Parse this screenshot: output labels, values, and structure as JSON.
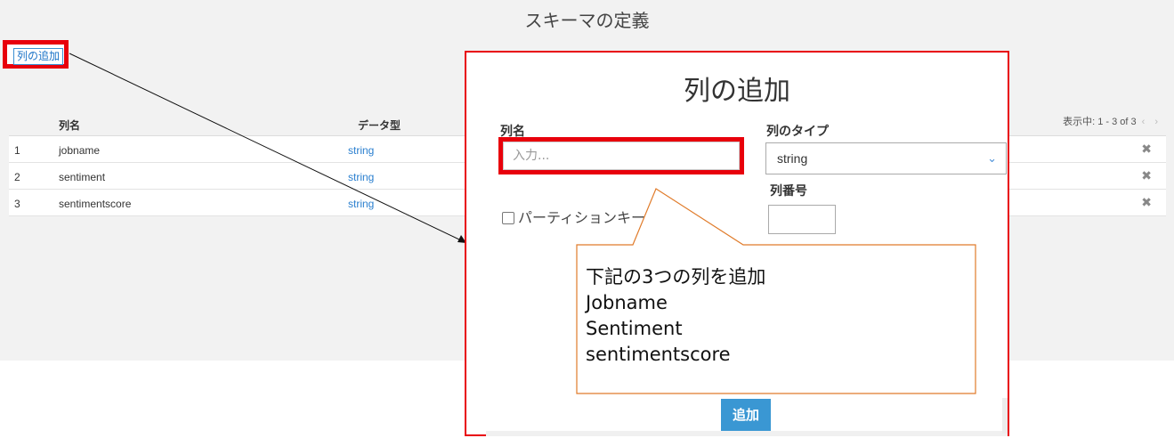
{
  "page": {
    "title": "スキーマの定義"
  },
  "toolbar": {
    "add_column_label": "列の追加"
  },
  "pager": {
    "text": "表示中: 1 - 3 of 3",
    "arrows": "‹ ›"
  },
  "table": {
    "headers": {
      "name": "列名",
      "type": "データ型"
    },
    "rows": [
      {
        "num": "1",
        "name": "jobname",
        "type": "string",
        "delete_icon": "✖"
      },
      {
        "num": "2",
        "name": "sentiment",
        "type": "string",
        "delete_icon": "✖"
      },
      {
        "num": "3",
        "name": "sentimentscore",
        "type": "string",
        "delete_icon": "✖"
      }
    ]
  },
  "modal": {
    "title": "列の追加",
    "name_label": "列名",
    "name_placeholder": "入力...",
    "type_label": "列のタイプ",
    "type_value": "string",
    "type_chevron": "⌄",
    "number_label": "列番号",
    "partition_label": "パーティションキー",
    "add_button": "追加"
  },
  "callout": {
    "lines": [
      "下記の3つの列を追加",
      "Jobname",
      "Sentiment",
      "sentimentscore"
    ]
  },
  "colors": {
    "highlight": "#e8000b",
    "accent": "#3a97d3",
    "callout_border": "#e07b2a"
  }
}
